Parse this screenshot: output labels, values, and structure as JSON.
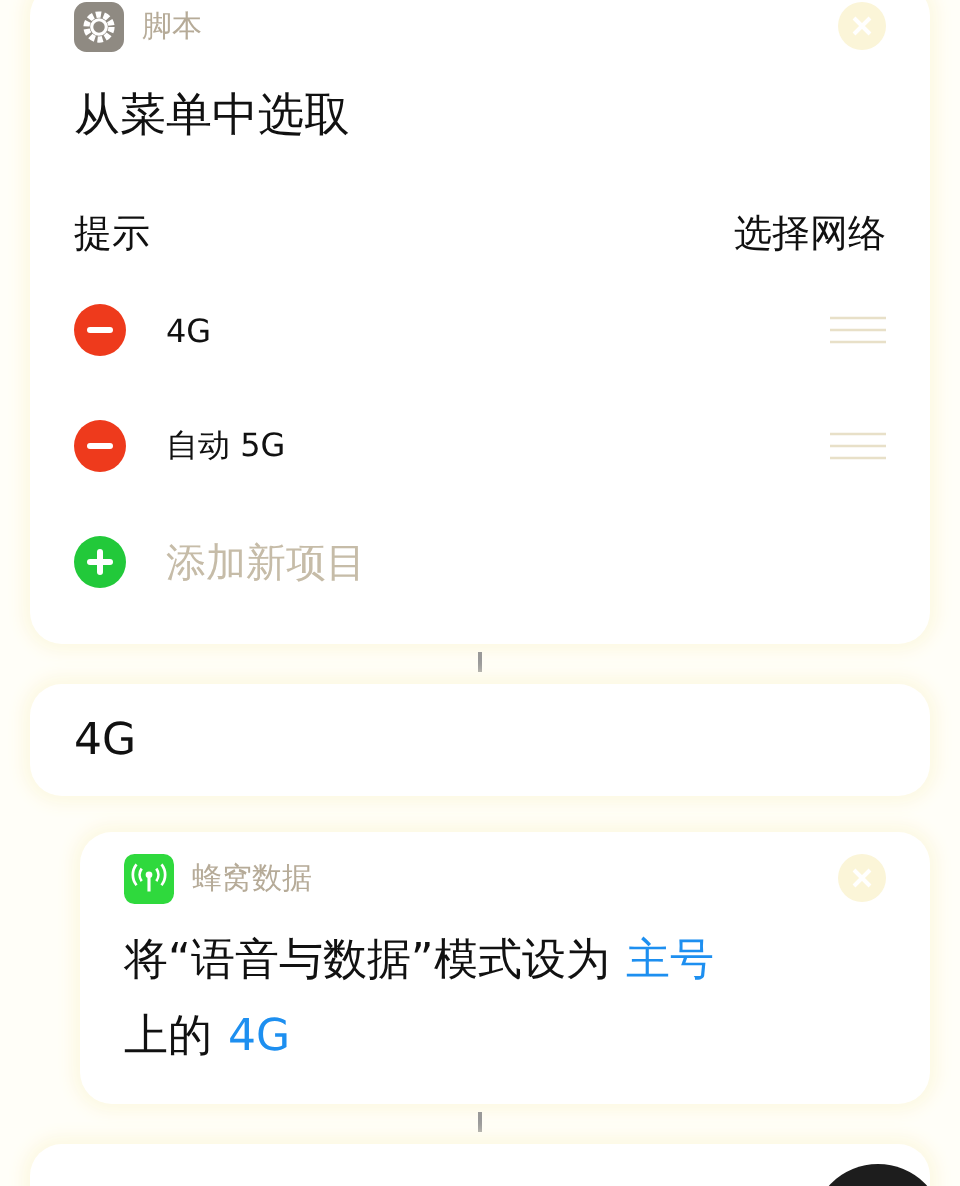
{
  "menu_action": {
    "app": "脚本",
    "title": "从菜单中选取",
    "prompt_label": "提示",
    "prompt_value": "选择网络",
    "items": [
      {
        "kind": "remove",
        "label": "4G"
      },
      {
        "kind": "remove",
        "label": "自动 5G"
      },
      {
        "kind": "add",
        "label": "添加新项目"
      }
    ]
  },
  "result": {
    "label": "4G"
  },
  "cellular_action": {
    "app": "蜂窝数据",
    "parts": [
      {
        "kind": "plain",
        "text": "将“语音与数据”模式设为"
      },
      {
        "kind": "param",
        "text": "主号"
      },
      {
        "kind": "plain",
        "text": "上的"
      },
      {
        "kind": "param",
        "text": "4G"
      }
    ]
  }
}
